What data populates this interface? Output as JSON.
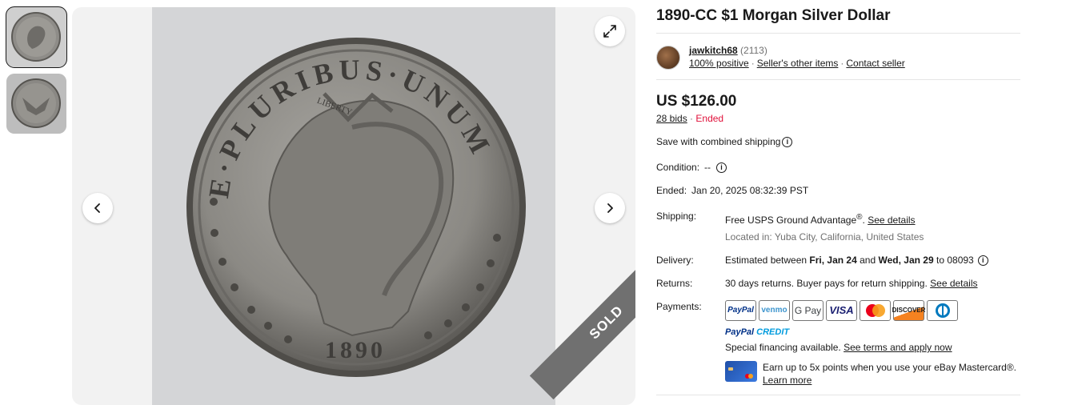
{
  "listing": {
    "title": "1890-CC $1 Morgan Silver Dollar",
    "price": "US $126.00",
    "bids": "28 bids",
    "bid_sep": "·",
    "status": "Ended",
    "combined_shipping": "Save with combined shipping"
  },
  "seller": {
    "name": "jawkitch68",
    "feedback_count": "(2113)",
    "positive": "100% positive",
    "sep": "·",
    "other_items": "Seller's other items",
    "contact": "Contact seller"
  },
  "gallery": {
    "sold_label": "SOLD",
    "coin_legend": "E·PLURIBUS·UNUM",
    "coin_year": "1890",
    "coin_headband": "LIBERTY"
  },
  "details": {
    "condition_label": "Condition:",
    "condition_value": "--",
    "ended_label": "Ended:",
    "ended_value": "Jan 20, 2025 08:32:39 PST",
    "shipping_label": "Shipping:",
    "shipping_free": "Free",
    "shipping_service": "USPS Ground Advantage",
    "shipping_reg": "®",
    "shipping_dot": ".",
    "shipping_link": "See details",
    "located": "Located in: Yuba City, California, United States",
    "delivery_label": "Delivery:",
    "delivery_prefix": "Estimated between",
    "delivery_from": "Fri, Jan 24",
    "delivery_and": "and",
    "delivery_to": "Wed, Jan 29",
    "delivery_zip_prefix": "to",
    "delivery_zip": "08093",
    "returns_label": "Returns:",
    "returns_value": "30 days returns. Buyer pays for return shipping.",
    "returns_link": "See details",
    "payments_label": "Payments:",
    "payment_methods": [
      "PayPal",
      "venmo",
      "G Pay",
      "VISA",
      "Mastercard",
      "DISCOVER",
      "Diners Club"
    ],
    "paypal_credit_a": "PayPal",
    "paypal_credit_b": "CREDIT",
    "financing": "Special financing available.",
    "financing_link": "See terms and apply now",
    "mastercard_promo": "Earn up to 5x points when you use your eBay Mastercard®.",
    "learn_more": "Learn more"
  },
  "colors": {
    "accent": "#191919",
    "ended": "#e0103a",
    "muted": "#707070"
  }
}
